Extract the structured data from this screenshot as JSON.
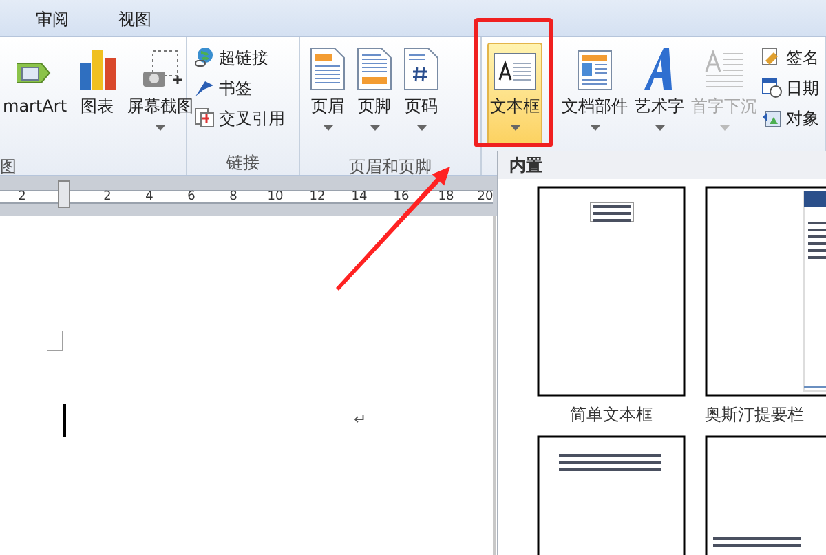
{
  "tabs": [
    {
      "label": "审阅",
      "selected": false
    },
    {
      "label": "视图",
      "selected": false
    }
  ],
  "ribbon": {
    "groups": [
      {
        "label": "图",
        "items": [
          {
            "kind": "large",
            "label": "martArt",
            "dropdown": false,
            "disabled": false,
            "selected": false
          },
          {
            "kind": "large",
            "label": "图表",
            "dropdown": false,
            "disabled": false,
            "selected": false
          },
          {
            "kind": "large",
            "label": "屏幕截图",
            "dropdown": true,
            "disabled": false,
            "selected": false
          }
        ]
      },
      {
        "label": "链接",
        "items": [
          {
            "kind": "small",
            "label": "超链接"
          },
          {
            "kind": "small",
            "label": "书签"
          },
          {
            "kind": "small",
            "label": "交叉引用"
          }
        ]
      },
      {
        "label": "页眉和页脚",
        "items": [
          {
            "kind": "large",
            "label": "页眉",
            "dropdown": true,
            "disabled": false,
            "selected": false
          },
          {
            "kind": "large",
            "label": "页脚",
            "dropdown": true,
            "disabled": false,
            "selected": false
          },
          {
            "kind": "large",
            "label": "页码",
            "dropdown": true,
            "disabled": false,
            "selected": false
          }
        ]
      },
      {
        "items": [
          {
            "kind": "large",
            "label": "文本框",
            "dropdown": true,
            "disabled": false,
            "selected": true
          },
          {
            "kind": "large",
            "label": "文档部件",
            "dropdown": true,
            "disabled": false,
            "selected": false
          },
          {
            "kind": "large",
            "label": "艺术字",
            "dropdown": true,
            "disabled": false,
            "selected": false
          },
          {
            "kind": "large",
            "label": "首字下沉",
            "dropdown": true,
            "disabled": true,
            "selected": false
          },
          {
            "kind": "small",
            "label": "签名"
          },
          {
            "kind": "small",
            "label": "日期"
          },
          {
            "kind": "small",
            "label": "对象"
          }
        ]
      }
    ]
  },
  "ruler": {
    "labels": [
      "2",
      "2",
      "4",
      "6",
      "8",
      "10",
      "12",
      "14",
      "16",
      "18",
      "20"
    ]
  },
  "document": {
    "paragraph_mark": "↵"
  },
  "gallery": {
    "heading": "内置",
    "items": [
      {
        "label": "简单文本框"
      },
      {
        "label": "奥斯汀提要栏"
      },
      {
        "kind": "picture"
      },
      {
        "kind": "picture"
      }
    ]
  }
}
